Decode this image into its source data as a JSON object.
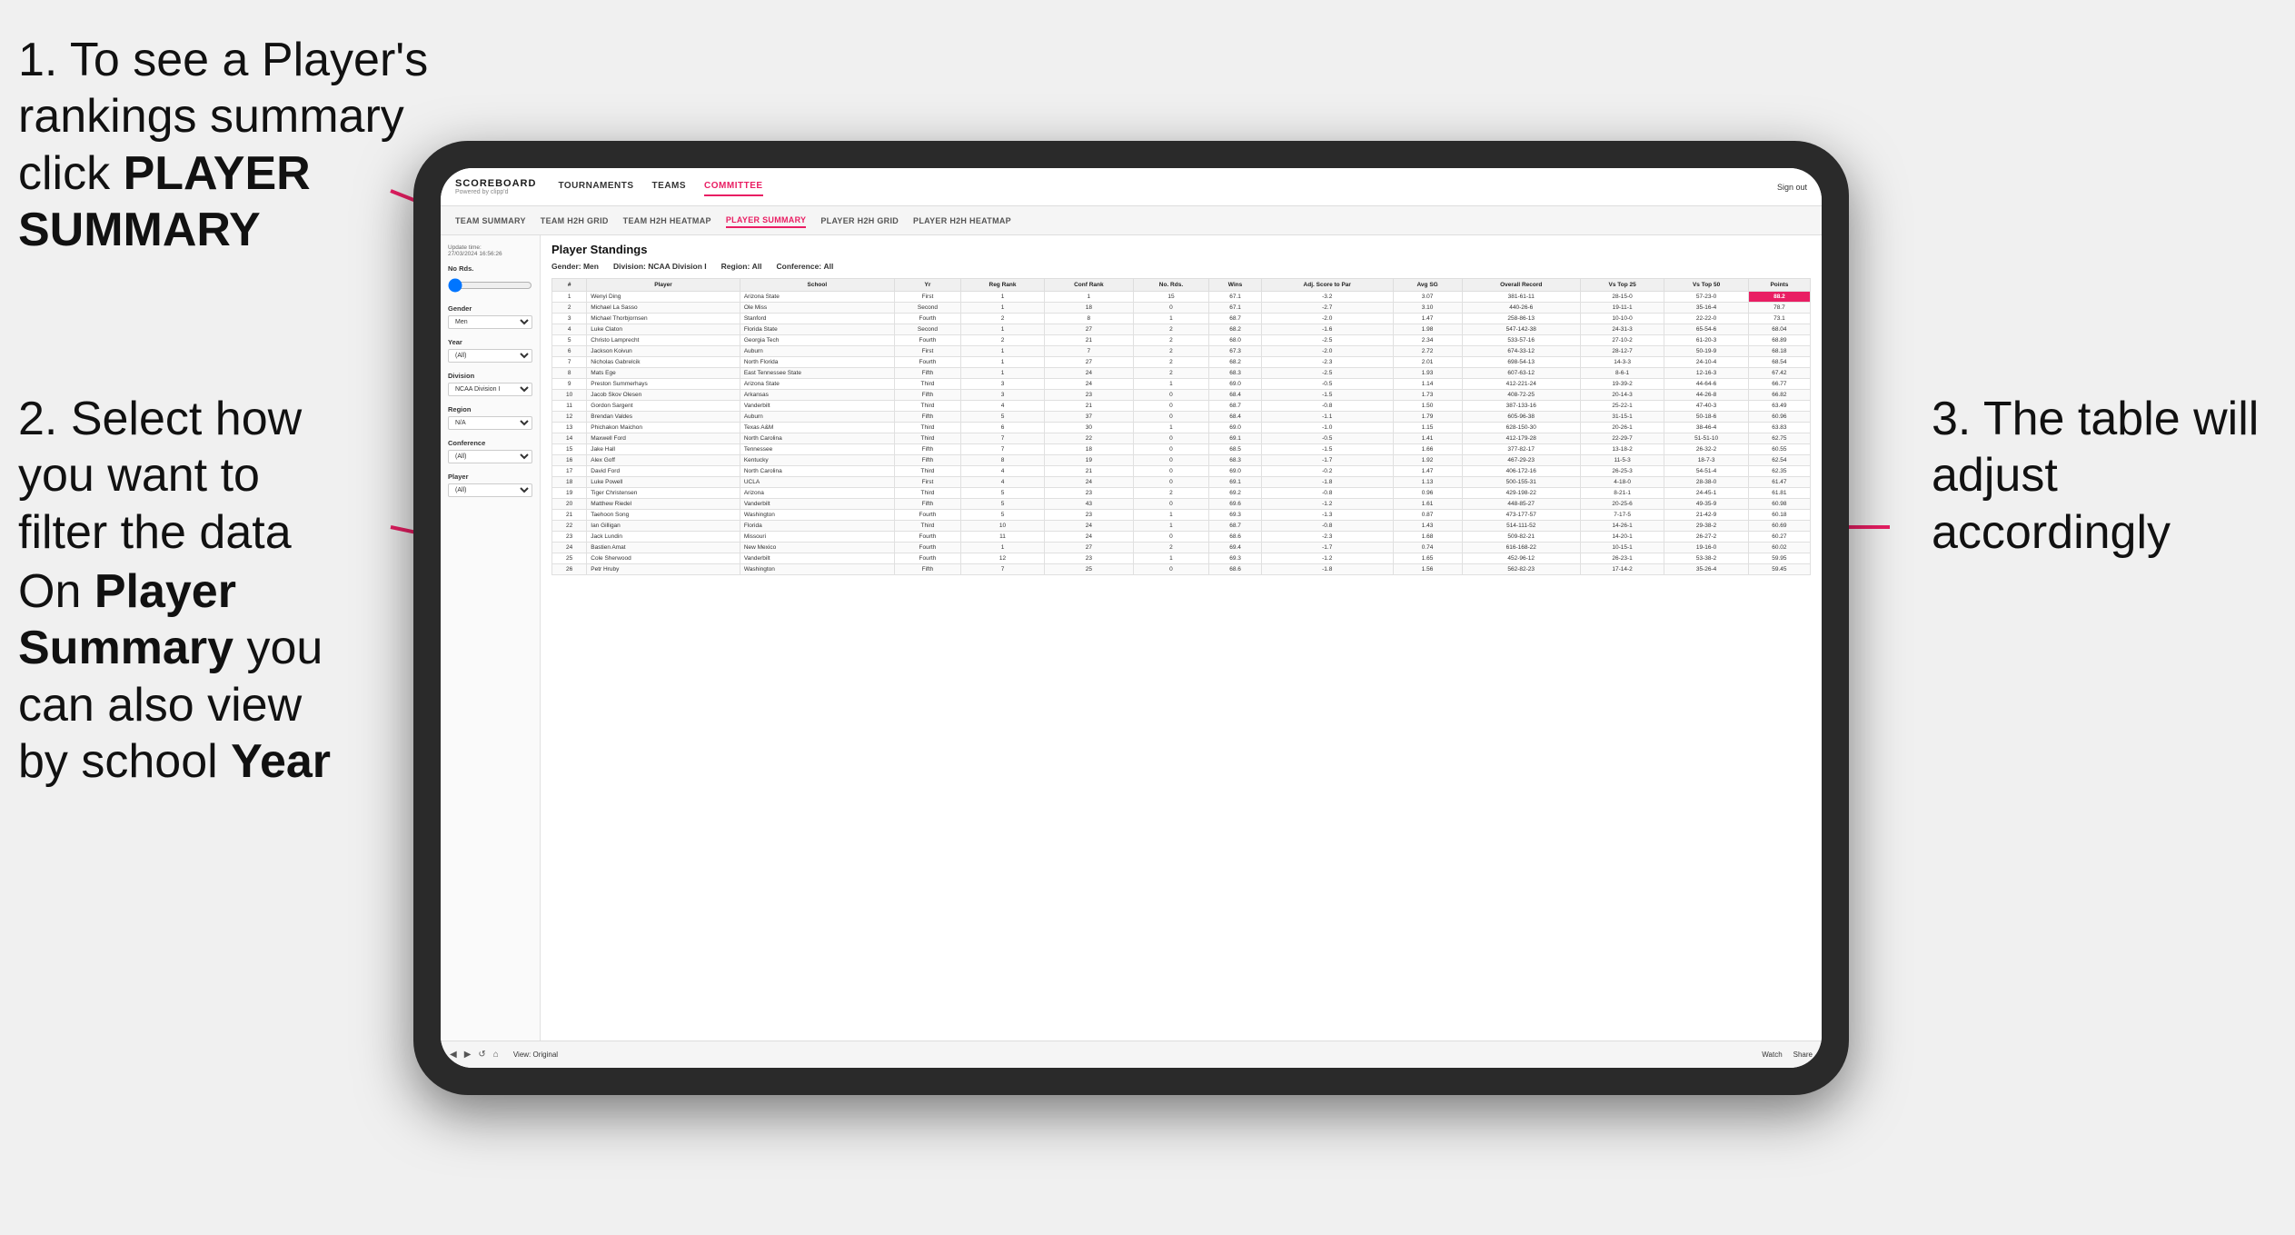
{
  "instructions": {
    "step1": "1. To see a Player's rankings summary click ",
    "step1_bold": "PLAYER SUMMARY",
    "step2_line1": "2. Select how you want to",
    "step2_line2": "filter the data",
    "step_bottom_line1": "On ",
    "step_bottom_bold1": "Player",
    "step_bottom_line2": "Summary",
    "step_bottom_line3": " you can also view by school ",
    "step_bottom_bold2": "Year",
    "step3_line1": "3. The table will",
    "step3_line2": "adjust accordingly"
  },
  "nav": {
    "logo": "SCOREBOARD",
    "logo_sub": "Powered by clipp'd",
    "items": [
      "TOURNAMENTS",
      "TEAMS",
      "COMMITTEE"
    ],
    "sign_out": "Sign out"
  },
  "sub_nav": {
    "items": [
      "TEAM SUMMARY",
      "TEAM H2H GRID",
      "TEAM H2H HEATMAP",
      "PLAYER SUMMARY",
      "PLAYER H2H GRID",
      "PLAYER H2H HEATMAP"
    ],
    "active": "PLAYER SUMMARY"
  },
  "sidebar": {
    "update_label": "Update time:",
    "update_time": "27/03/2024 16:56:26",
    "no_rds_label": "No Rds.",
    "gender_label": "Gender",
    "gender_value": "Men",
    "year_label": "Year",
    "year_value": "(All)",
    "division_label": "Division",
    "division_value": "NCAA Division I",
    "region_label": "Region",
    "region_value": "N/A",
    "conference_label": "Conference",
    "conference_value": "(All)",
    "player_label": "Player",
    "player_value": "(All)"
  },
  "table": {
    "title": "Player Standings",
    "filters": {
      "gender_label": "Gender:",
      "gender_value": "Men",
      "division_label": "Division:",
      "division_value": "NCAA Division I",
      "region_label": "Region:",
      "region_value": "All",
      "conference_label": "Conference:",
      "conference_value": "All"
    },
    "columns": [
      "#",
      "Player",
      "School",
      "Yr",
      "Reg Rank",
      "Conf Rank",
      "No. Rds.",
      "Wins",
      "Adj. Score to Par",
      "Avg SG",
      "Overall Record",
      "Vs Top 25",
      "Vs Top 50",
      "Points"
    ],
    "rows": [
      [
        "1",
        "Wenyi Ding",
        "Arizona State",
        "First",
        "1",
        "1",
        "15",
        "67.1",
        "-3.2",
        "3.07",
        "381-61-11",
        "28-15-0",
        "57-23-0",
        "88.2"
      ],
      [
        "2",
        "Michael La Sasso",
        "Ole Miss",
        "Second",
        "1",
        "18",
        "0",
        "67.1",
        "-2.7",
        "3.10",
        "440-26-6",
        "19-11-1",
        "35-16-4",
        "78.7"
      ],
      [
        "3",
        "Michael Thorbjornsen",
        "Stanford",
        "Fourth",
        "2",
        "8",
        "1",
        "68.7",
        "-2.0",
        "1.47",
        "258-86-13",
        "10-10-0",
        "22-22-0",
        "73.1"
      ],
      [
        "4",
        "Luke Claton",
        "Florida State",
        "Second",
        "1",
        "27",
        "2",
        "68.2",
        "-1.6",
        "1.98",
        "547-142-38",
        "24-31-3",
        "65-54-6",
        "68.04"
      ],
      [
        "5",
        "Christo Lamprecht",
        "Georgia Tech",
        "Fourth",
        "2",
        "21",
        "2",
        "68.0",
        "-2.5",
        "2.34",
        "533-57-16",
        "27-10-2",
        "61-20-3",
        "68.89"
      ],
      [
        "6",
        "Jackson Koivun",
        "Auburn",
        "First",
        "1",
        "7",
        "2",
        "67.3",
        "-2.0",
        "2.72",
        "674-33-12",
        "28-12-7",
        "50-19-9",
        "68.18"
      ],
      [
        "7",
        "Nicholas Gabrelcik",
        "North Florida",
        "Fourth",
        "1",
        "27",
        "2",
        "68.2",
        "-2.3",
        "2.01",
        "698-54-13",
        "14-3-3",
        "24-10-4",
        "68.54"
      ],
      [
        "8",
        "Mats Ege",
        "East Tennessee State",
        "Fifth",
        "1",
        "24",
        "2",
        "68.3",
        "-2.5",
        "1.93",
        "607-63-12",
        "8-6-1",
        "12-16-3",
        "67.42"
      ],
      [
        "9",
        "Preston Summerhays",
        "Arizona State",
        "Third",
        "3",
        "24",
        "1",
        "69.0",
        "-0.5",
        "1.14",
        "412-221-24",
        "19-39-2",
        "44-64-6",
        "66.77"
      ],
      [
        "10",
        "Jacob Skov Olesen",
        "Arkansas",
        "Fifth",
        "3",
        "23",
        "0",
        "68.4",
        "-1.5",
        "1.73",
        "408-72-25",
        "20-14-3",
        "44-26-8",
        "66.82"
      ],
      [
        "11",
        "Gordon Sargent",
        "Vanderbilt",
        "Third",
        "4",
        "21",
        "0",
        "68.7",
        "-0.8",
        "1.50",
        "387-133-16",
        "25-22-1",
        "47-40-3",
        "63.49"
      ],
      [
        "12",
        "Brendan Valdes",
        "Auburn",
        "Fifth",
        "5",
        "37",
        "0",
        "68.4",
        "-1.1",
        "1.79",
        "605-96-38",
        "31-15-1",
        "50-18-6",
        "60.96"
      ],
      [
        "13",
        "Phichakon Maichon",
        "Texas A&M",
        "Third",
        "6",
        "30",
        "1",
        "69.0",
        "-1.0",
        "1.15",
        "628-150-30",
        "20-26-1",
        "38-46-4",
        "63.83"
      ],
      [
        "14",
        "Maxwell Ford",
        "North Carolina",
        "Third",
        "7",
        "22",
        "0",
        "69.1",
        "-0.5",
        "1.41",
        "412-179-28",
        "22-29-7",
        "51-51-10",
        "62.75"
      ],
      [
        "15",
        "Jake Hall",
        "Tennessee",
        "Fifth",
        "7",
        "18",
        "0",
        "68.5",
        "-1.5",
        "1.66",
        "377-82-17",
        "13-18-2",
        "26-32-2",
        "60.55"
      ],
      [
        "16",
        "Alex Goff",
        "Kentucky",
        "Fifth",
        "8",
        "19",
        "0",
        "68.3",
        "-1.7",
        "1.92",
        "467-29-23",
        "11-5-3",
        "18-7-3",
        "62.54"
      ],
      [
        "17",
        "David Ford",
        "North Carolina",
        "Third",
        "4",
        "21",
        "0",
        "69.0",
        "-0.2",
        "1.47",
        "406-172-16",
        "26-25-3",
        "54-51-4",
        "62.35"
      ],
      [
        "18",
        "Luke Powell",
        "UCLA",
        "First",
        "4",
        "24",
        "0",
        "69.1",
        "-1.8",
        "1.13",
        "500-155-31",
        "4-18-0",
        "28-38-0",
        "61.47"
      ],
      [
        "19",
        "Tiger Christensen",
        "Arizona",
        "Third",
        "5",
        "23",
        "2",
        "69.2",
        "-0.8",
        "0.96",
        "429-198-22",
        "8-21-1",
        "24-45-1",
        "61.81"
      ],
      [
        "20",
        "Matthew Riedel",
        "Vanderbilt",
        "Fifth",
        "5",
        "43",
        "0",
        "69.6",
        "-1.2",
        "1.61",
        "448-85-27",
        "20-25-6",
        "49-35-9",
        "60.98"
      ],
      [
        "21",
        "Taehoon Song",
        "Washington",
        "Fourth",
        "5",
        "23",
        "1",
        "69.3",
        "-1.3",
        "0.87",
        "473-177-57",
        "7-17-5",
        "21-42-9",
        "60.18"
      ],
      [
        "22",
        "Ian Gilligan",
        "Florida",
        "Third",
        "10",
        "24",
        "1",
        "68.7",
        "-0.8",
        "1.43",
        "514-111-52",
        "14-26-1",
        "29-38-2",
        "60.69"
      ],
      [
        "23",
        "Jack Lundin",
        "Missouri",
        "Fourth",
        "11",
        "24",
        "0",
        "68.6",
        "-2.3",
        "1.68",
        "509-82-21",
        "14-20-1",
        "26-27-2",
        "60.27"
      ],
      [
        "24",
        "Bastien Amat",
        "New Mexico",
        "Fourth",
        "1",
        "27",
        "2",
        "69.4",
        "-1.7",
        "0.74",
        "616-168-22",
        "10-15-1",
        "19-16-0",
        "60.02"
      ],
      [
        "25",
        "Cole Sherwood",
        "Vanderbilt",
        "Fourth",
        "12",
        "23",
        "1",
        "69.3",
        "-1.2",
        "1.65",
        "452-96-12",
        "26-23-1",
        "53-38-2",
        "59.95"
      ],
      [
        "26",
        "Petr Hruby",
        "Washington",
        "Fifth",
        "7",
        "25",
        "0",
        "68.6",
        "-1.8",
        "1.56",
        "562-82-23",
        "17-14-2",
        "35-26-4",
        "59.45"
      ]
    ]
  },
  "toolbar": {
    "view_label": "View: Original",
    "watch_label": "Watch",
    "share_label": "Share"
  }
}
